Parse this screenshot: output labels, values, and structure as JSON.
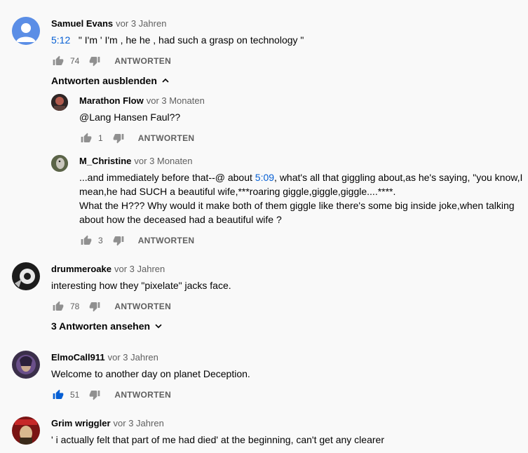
{
  "comments": [
    {
      "author": "Samuel Evans",
      "time": "vor 3 Jahren",
      "timestamp_link": "5:12",
      "text": "\" I'm ' I'm , he he , had such a grasp on technology \"",
      "likes": "74",
      "reply_label": "ANTWORTEN",
      "replies_toggle": "Antworten ausblenden",
      "replies": [
        {
          "author": "Marathon Flow",
          "time": "vor 3 Monaten",
          "text": "@Lang Hansen Faul??",
          "likes": "1",
          "reply_label": "ANTWORTEN"
        },
        {
          "author": "M_Christine",
          "time": "vor 3 Monaten",
          "text_before": "...and immediately before that--@ about ",
          "timestamp_link": "5:09",
          "text_line1_after": ", what's all that giggling about,as he's saying, \"you know,I",
          "text_line2": "mean,he had SUCH a beautiful wife,***roaring giggle,giggle,giggle....****.",
          "text_line3": "What the H??? Why would it make both of them giggle like there's some big inside joke,when talking",
          "text_line4": "about how the deceased had a beautiful wife ?",
          "likes": "3",
          "reply_label": "ANTWORTEN"
        }
      ]
    },
    {
      "author": "drummeroake",
      "time": "vor 3 Jahren",
      "text": "interesting how they \"pixelate\" jacks face.",
      "likes": "78",
      "reply_label": "ANTWORTEN",
      "replies_toggle": "3 Antworten ansehen"
    },
    {
      "author": "ElmoCall911",
      "time": "vor 3 Jahren",
      "text": "Welcome to another day on planet Deception.",
      "likes": "51",
      "liked": true,
      "reply_label": "ANTWORTEN"
    },
    {
      "author": "Grim wriggler",
      "time": "vor 3 Jahren",
      "text": "' i actually felt that part of me had died' at the beginning, can't get any clearer"
    }
  ],
  "colors": {
    "link_blue": "#065fd4",
    "text": "#030303",
    "secondary": "#606060",
    "background": "#f9f9f9"
  },
  "icons": [
    "default-avatar-icon",
    "thumbs-up-icon",
    "thumbs-down-icon",
    "chevron-up-icon",
    "chevron-down-icon"
  ]
}
